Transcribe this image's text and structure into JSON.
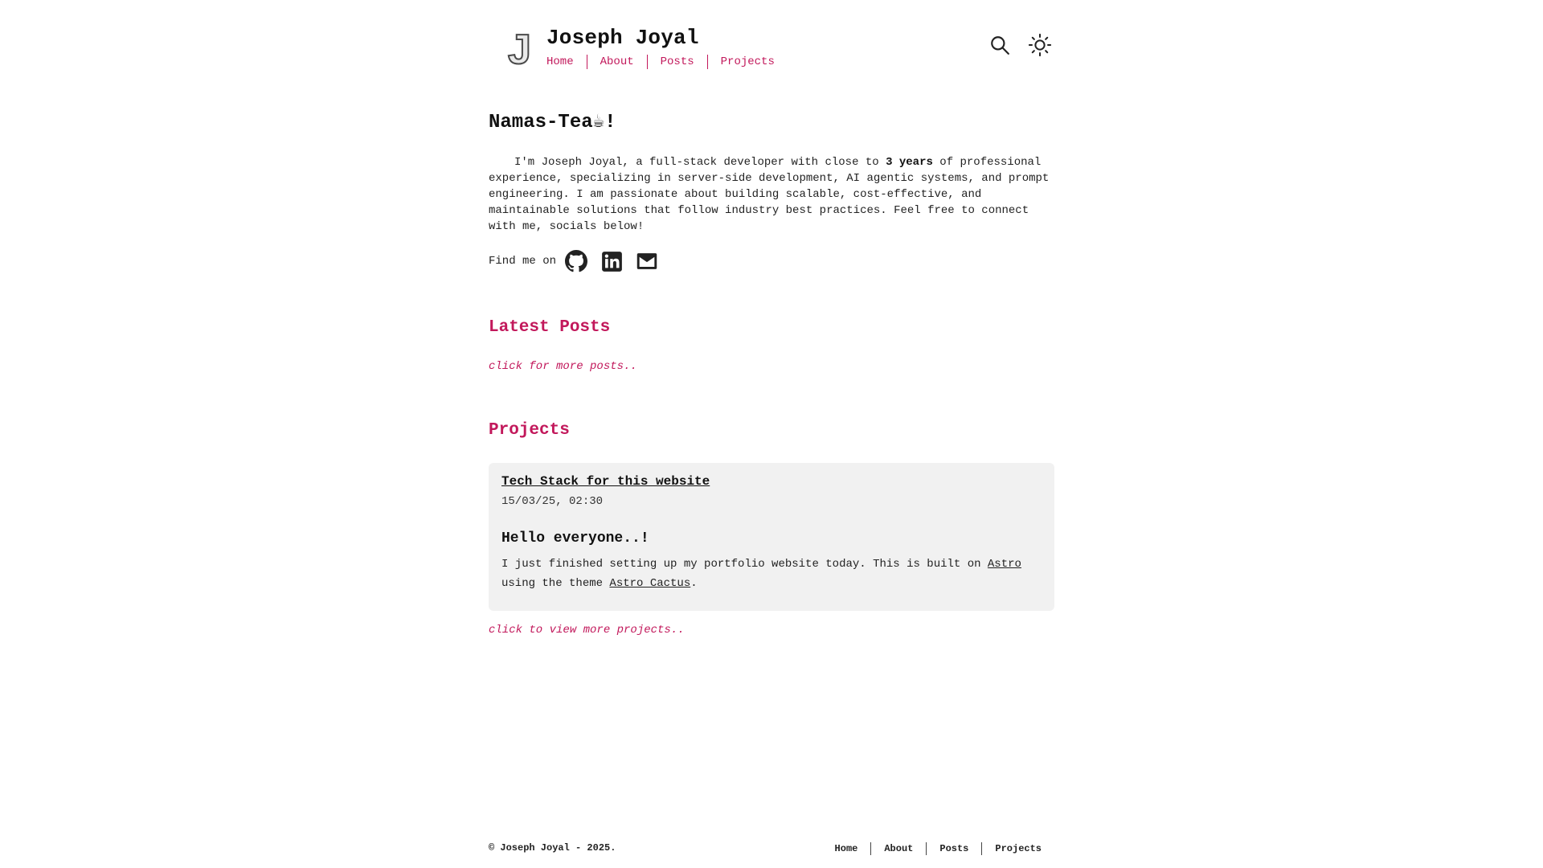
{
  "header": {
    "logo_letter": "J",
    "site_title": "Joseph Joyal",
    "nav": [
      "Home",
      "About",
      "Posts",
      "Projects"
    ],
    "search_icon": "search-icon",
    "theme_icon": "sun-icon"
  },
  "intro": {
    "title": "Namas-Tea☕!",
    "text_before": "I'm Joseph Joyal, a full-stack developer with close to ",
    "text_bold": "3 years",
    "text_after": " of professional experience, specializing in server-side development, AI agentic systems, and prompt engineering. I am passionate about building scalable, cost-effective, and maintainable solutions that follow industry best practices. Feel free to connect with me, socials below!",
    "find_me": "Find me on",
    "socials": [
      "github-icon",
      "linkedin-icon",
      "mail-icon"
    ]
  },
  "latest_posts": {
    "title": "Latest Posts",
    "more_link": "click for more posts.."
  },
  "projects": {
    "title": "Projects",
    "card": {
      "title": "Tech Stack for this website",
      "date": "15/03/25, 02:30",
      "heading": "Hello everyone..!",
      "body_before": "I just finished setting up my portfolio website today. This is built on ",
      "link1": "Astro",
      "body_middle": " using the theme ",
      "link2": "Astro Cactus",
      "body_after": "."
    },
    "more_link": "click to view more projects.."
  },
  "footer": {
    "copyright": "© Joseph Joyal - 2025.",
    "nav": [
      "Home",
      "About",
      "Posts",
      "Projects"
    ]
  },
  "colors": {
    "accent": "#c2185b",
    "text": "#222222",
    "card_bg": "#f1f1f1",
    "background": "#ffffff"
  }
}
